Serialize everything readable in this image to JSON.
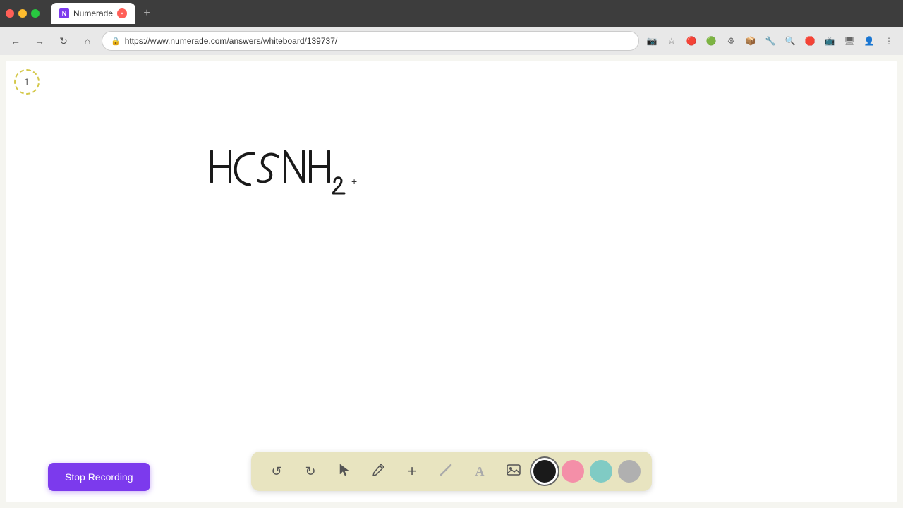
{
  "browser": {
    "tab_title": "Numerade",
    "tab_favicon_text": "N",
    "tab_close_label": "×",
    "new_tab_label": "+",
    "url": "https://www.numerade.com/answers/whiteboard/139737/",
    "nav": {
      "back_icon": "←",
      "forward_icon": "→",
      "refresh_icon": "↻",
      "home_icon": "⌂",
      "lock_icon": "🔒"
    }
  },
  "whiteboard": {
    "page_number": "1",
    "formula_text": "HCSNHâ‚‚"
  },
  "toolbar": {
    "tools": [
      {
        "name": "undo",
        "icon": "↺",
        "label": "Undo"
      },
      {
        "name": "redo",
        "icon": "↻",
        "label": "Redo"
      },
      {
        "name": "select",
        "icon": "▲",
        "label": "Select"
      },
      {
        "name": "pen",
        "icon": "✏",
        "label": "Pen"
      },
      {
        "name": "add",
        "icon": "+",
        "label": "Add"
      },
      {
        "name": "eraser",
        "icon": "/",
        "label": "Eraser"
      },
      {
        "name": "text",
        "icon": "A",
        "label": "Text"
      },
      {
        "name": "image",
        "icon": "🖼",
        "label": "Image"
      }
    ],
    "colors": [
      {
        "name": "black",
        "hex": "#1a1a1a",
        "selected": true
      },
      {
        "name": "pink",
        "hex": "#f48fb1",
        "selected": false
      },
      {
        "name": "green",
        "hex": "#80cbc4",
        "selected": false
      },
      {
        "name": "gray",
        "hex": "#b0b0b0",
        "selected": false
      }
    ]
  },
  "stop_recording": {
    "label": "Stop Recording"
  }
}
